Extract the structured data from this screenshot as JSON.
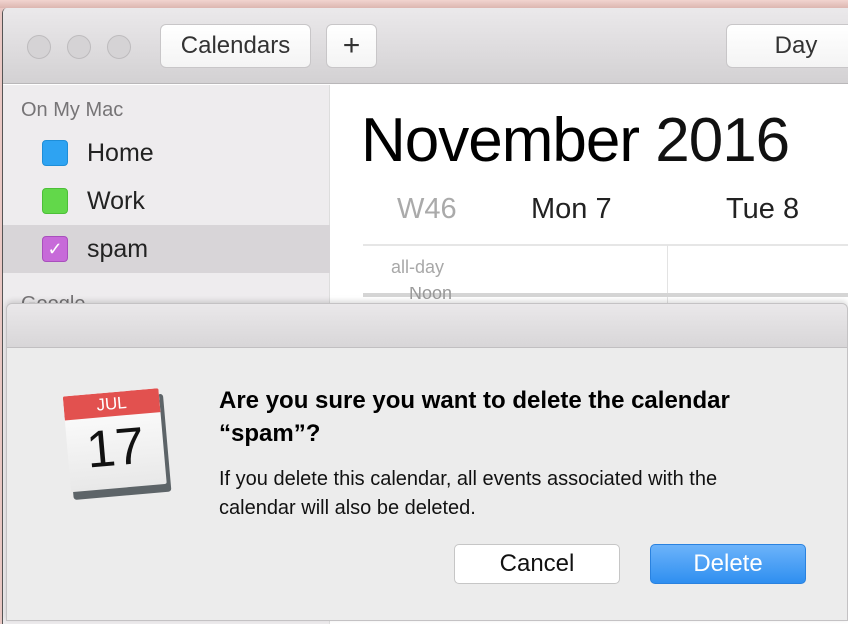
{
  "toolbar": {
    "calendars_label": "Calendars",
    "add_label": "+",
    "day_label": "Day"
  },
  "sidebar": {
    "section_on_my_mac": "On My Mac",
    "items": [
      {
        "label": "Home",
        "color": "#2ea3f2",
        "checked": false
      },
      {
        "label": "Work",
        "color": "#62d84a",
        "checked": false
      },
      {
        "label": "spam",
        "color": "#c76ad9",
        "checked": true,
        "selected": true
      }
    ],
    "section_google": "Google"
  },
  "calendar": {
    "month": "November",
    "year": "2016",
    "week": "W46",
    "days": [
      "Mon 7",
      "Tue 8"
    ],
    "allday_label": "all-day",
    "noon_label": "Noon"
  },
  "dialog": {
    "icon_month": "JUL",
    "icon_day": "17",
    "title": "Are you sure you want to delete the calendar “spam”?",
    "message": "If you delete this calendar, all events associated with the calendar will also be deleted.",
    "cancel_label": "Cancel",
    "delete_label": "Delete",
    "accent": "#2f8ff0"
  }
}
